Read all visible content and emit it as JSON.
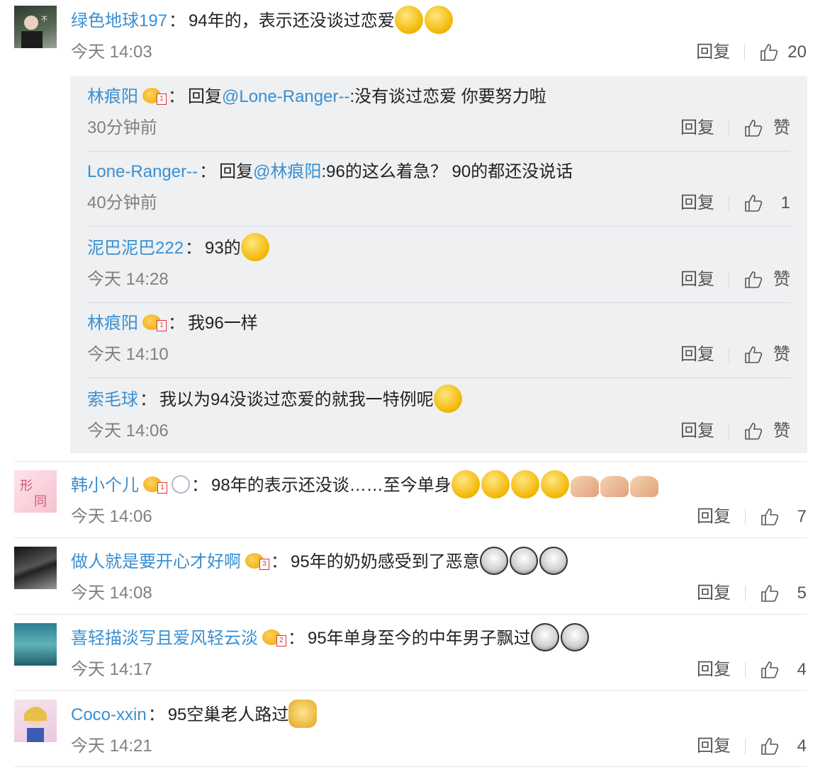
{
  "comments": [
    {
      "user": "绿色地球197",
      "text": "94年的，表示还没谈过恋爱",
      "time": "今天 14:03",
      "reply_label": "回复",
      "likes": "20",
      "emojis": [
        "dizzy-face",
        "crying-face"
      ],
      "replies": [
        {
          "user": "林痕阳",
          "prefix": "回复",
          "mention": "@Lone-Ranger--",
          "text": ":没有谈过恋爱  你要努力啦",
          "time": "30分钟前",
          "reply_label": "回复",
          "likes": "赞"
        },
        {
          "user": "Lone-Ranger--",
          "prefix": "回复",
          "mention": "@林痕阳",
          "text": ":96的这么着急？ 90的都还没说话",
          "time": "40分钟前",
          "reply_label": "回复",
          "likes": "1"
        },
        {
          "user": "泥巴泥巴222",
          "text": "93的",
          "time": "今天 14:28",
          "reply_label": "回复",
          "likes": "赞"
        },
        {
          "user": "林痕阳",
          "text": "我96一样",
          "time": "今天 14:10",
          "reply_label": "回复",
          "likes": "赞"
        },
        {
          "user": "索毛球",
          "text": "我以为94没谈过恋爱的就我一特例呢",
          "time": "今天 14:06",
          "reply_label": "回复",
          "likes": "赞"
        }
      ]
    },
    {
      "user": "韩小个儿",
      "text": "98年的表示还没谈……至今单身",
      "time": "今天 14:06",
      "reply_label": "回复",
      "likes": "7"
    },
    {
      "user": "做人就是要开心才好啊",
      "text": "95年的奶奶感受到了恶意",
      "time": "今天 14:08",
      "reply_label": "回复",
      "likes": "5"
    },
    {
      "user": "喜轻描淡写且爱风轻云淡",
      "text": "95年单身至今的中年男子飘过",
      "time": "今天 14:17",
      "reply_label": "回复",
      "likes": "4"
    },
    {
      "user": "Coco-xxin",
      "text": "95空巢老人路过",
      "time": "今天 14:21",
      "reply_label": "回复",
      "likes": "4"
    }
  ],
  "colon": "：",
  "badge_levels": [
    "1",
    "1",
    "1",
    "3",
    "2"
  ],
  "colors": {
    "username": "#3a8fd0",
    "reply_box_bg": "#eef0f2",
    "time": "#808080"
  }
}
